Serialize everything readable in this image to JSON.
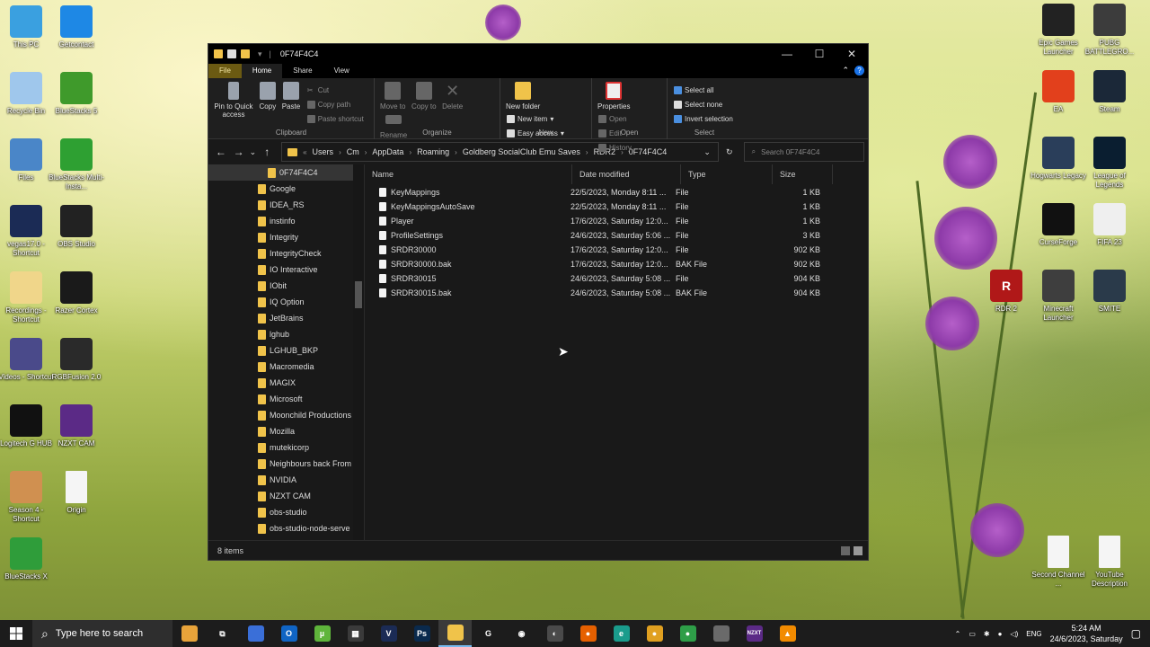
{
  "desktop_left": [
    {
      "label": "This PC",
      "icon": "this-pc-icon",
      "color": "#3aa0e0"
    },
    {
      "label": "Recycle Bin",
      "icon": "recycle-bin-icon",
      "color": "#9fc7ec"
    },
    {
      "label": "Files",
      "icon": "files-icon",
      "color": "#4a86c8"
    },
    {
      "label": "vegas17.0 - Shortcut",
      "icon": "vegas-icon",
      "color": "#1b2b55"
    },
    {
      "label": "Recordings - Shortcut",
      "icon": "folder-icon",
      "color": "#f0d68a"
    },
    {
      "label": "Videos - Shortcut",
      "icon": "videos-icon",
      "color": "#4a4a8a"
    },
    {
      "label": "Logitech G HUB",
      "icon": "logitech-icon",
      "color": "#111111"
    },
    {
      "label": "Season 4 - Shortcut",
      "icon": "season-icon",
      "color": "#d09050"
    },
    {
      "label": "BlueStacks X",
      "icon": "bluestacks-icon",
      "color": "#2f9d3a"
    }
  ],
  "desktop_left2": [
    {
      "label": "Getcontact",
      "icon": "getcontact-icon",
      "color": "#1e88e5"
    },
    {
      "label": "BlueStacks 5",
      "icon": "bluestacks-icon",
      "color": "#3f9a2b"
    },
    {
      "label": "BlueStacks Multi-Insta...",
      "icon": "bluestacks-multi-icon",
      "color": "#2ea032"
    },
    {
      "label": "OBS Studio",
      "icon": "obs-icon",
      "color": "#222222"
    },
    {
      "label": "Razer Cortex",
      "icon": "razer-icon",
      "color": "#1a1a1a"
    },
    {
      "label": "RGBFusion 2.0",
      "icon": "rgbfusion-icon",
      "color": "#2a2a2a"
    },
    {
      "label": "NZXT CAM",
      "icon": "nzxt-icon",
      "color": "#5b2a86"
    },
    {
      "label": "Origin",
      "icon": "file-icon",
      "color": "#f5f5f5"
    }
  ],
  "desktop_right1": [
    {
      "label": "Epic Games Launcher",
      "icon": "epic-icon",
      "color": "#222222"
    },
    {
      "label": "EA",
      "icon": "ea-icon",
      "color": "#e2401c"
    },
    {
      "label": "Hogwarts Legacy",
      "icon": "hogwarts-icon",
      "color": "#2a3e5a"
    },
    {
      "label": "CurseForge",
      "icon": "curseforge-icon",
      "color": "#111111"
    },
    {
      "label": "Minecraft Launcher",
      "icon": "minecraft-icon",
      "color": "#3e3e3e"
    },
    {
      "label": "Second Channel ...",
      "icon": "file-icon",
      "color": "#f5f5f5"
    }
  ],
  "desktop_right2": [
    {
      "label": "PUBG BATTLEGRO...",
      "icon": "pubg-icon",
      "color": "#3c3c3c"
    },
    {
      "label": "Steam",
      "icon": "steam-icon",
      "color": "#1b2838"
    },
    {
      "label": "League of Legends",
      "icon": "lol-icon",
      "color": "#0a1e30"
    },
    {
      "label": "FIFA 23",
      "icon": "fifa-icon",
      "color": "#efefef"
    },
    {
      "label": "SMITE",
      "icon": "smite-icon",
      "color": "#2a3a4a"
    },
    {
      "label": "YouTube Description",
      "icon": "file-icon",
      "color": "#f5f5f5"
    }
  ],
  "desktop_rdr": {
    "label": "RDR 2",
    "icon": "rdr2-icon",
    "color": "#b01818"
  },
  "window": {
    "title": "0F74F4C4",
    "tabs": [
      "File",
      "Home",
      "Share",
      "View"
    ],
    "ribbon": {
      "clipboard": {
        "pin": "Pin to Quick access",
        "copy": "Copy",
        "paste": "Paste",
        "cut": "Cut",
        "copy_path": "Copy path",
        "paste_shortcut": "Paste shortcut",
        "label": "Clipboard"
      },
      "organize": {
        "move": "Move to",
        "copy": "Copy to",
        "delete": "Delete",
        "rename": "Rename",
        "label": "Organize"
      },
      "new": {
        "folder": "New folder",
        "item": "New item",
        "easy": "Easy access",
        "label": "New"
      },
      "open": {
        "properties": "Properties",
        "open": "Open",
        "edit": "Edit",
        "history": "History",
        "label": "Open"
      },
      "select": {
        "all": "Select all",
        "none": "Select none",
        "invert": "Invert selection",
        "label": "Select"
      }
    },
    "breadcrumb": [
      "Users",
      "Cm",
      "AppData",
      "Roaming",
      "Goldberg SocialClub Emu Saves",
      "RDR2",
      "0F74F4C4"
    ],
    "search_placeholder": "Search 0F74F4C4",
    "nav_selected": "0F74F4C4",
    "nav_items": [
      "Google",
      "IDEA_RS",
      "instinfo",
      "Integrity",
      "IntegrityCheck",
      "IO Interactive",
      "IObit",
      "IQ Option",
      "JetBrains",
      "lghub",
      "LGHUB_BKP",
      "Macromedia",
      "MAGIX",
      "Microsoft",
      "Moonchild Productions",
      "Mozilla",
      "mutekicorp",
      "Neighbours back From",
      "NVIDIA",
      "NZXT CAM",
      "obs-studio",
      "obs-studio-node-serve"
    ],
    "columns": [
      "Name",
      "Date modified",
      "Type",
      "Size"
    ],
    "files": [
      {
        "name": "KeyMappings",
        "date": "22/5/2023, Monday 8:11 ...",
        "type": "File",
        "size": "1 KB"
      },
      {
        "name": "KeyMappingsAutoSave",
        "date": "22/5/2023, Monday 8:11 ...",
        "type": "File",
        "size": "1 KB"
      },
      {
        "name": "Player",
        "date": "17/6/2023, Saturday 12:0...",
        "type": "File",
        "size": "1 KB"
      },
      {
        "name": "ProfileSettings",
        "date": "24/6/2023, Saturday 5:06 ...",
        "type": "File",
        "size": "3 KB"
      },
      {
        "name": "SRDR30000",
        "date": "17/6/2023, Saturday 12:0...",
        "type": "File",
        "size": "902 KB"
      },
      {
        "name": "SRDR30000.bak",
        "date": "17/6/2023, Saturday 12:0...",
        "type": "BAK File",
        "size": "902 KB"
      },
      {
        "name": "SRDR30015",
        "date": "24/6/2023, Saturday 5:08 ...",
        "type": "File",
        "size": "904 KB"
      },
      {
        "name": "SRDR30015.bak",
        "date": "24/6/2023, Saturday 5:08 ...",
        "type": "BAK File",
        "size": "904 KB"
      }
    ],
    "status": "8 items"
  },
  "taskbar": {
    "search_placeholder": "Type here to search",
    "apps": [
      {
        "name": "taskbar-app-1",
        "color": "#e8a33a",
        "glyph": ""
      },
      {
        "name": "task-view-icon",
        "color": "#1c1c1c",
        "glyph": "⧉"
      },
      {
        "name": "store-icon",
        "color": "#3a6fd8",
        "glyph": ""
      },
      {
        "name": "outlook-icon",
        "color": "#1065c4",
        "glyph": "O"
      },
      {
        "name": "utorrent-icon",
        "color": "#5fb53b",
        "glyph": "µ"
      },
      {
        "name": "calculator-icon",
        "color": "#3a3a3a",
        "glyph": "▦"
      },
      {
        "name": "vegas-icon",
        "color": "#1b2b55",
        "glyph": "V"
      },
      {
        "name": "photoshop-icon",
        "color": "#0a2a4d",
        "glyph": "Ps"
      },
      {
        "name": "file-explorer-icon",
        "color": "#f0c34a",
        "glyph": ""
      },
      {
        "name": "logitech-icon",
        "color": "#1c1c1c",
        "glyph": "G"
      },
      {
        "name": "obs-icon",
        "color": "#1c1c1c",
        "glyph": "◉"
      },
      {
        "name": "cortana-icon",
        "color": "#4a4a4a",
        "glyph": "◐"
      },
      {
        "name": "firefox-icon",
        "color": "#e66000",
        "glyph": "●"
      },
      {
        "name": "edge-icon",
        "color": "#1a9c8c",
        "glyph": "e"
      },
      {
        "name": "chrome-dev-icon",
        "color": "#e0a020",
        "glyph": "●"
      },
      {
        "name": "chrome-icon",
        "color": "#2e9e48",
        "glyph": "●"
      },
      {
        "name": "taskbar-app-17",
        "color": "#6a6a6a",
        "glyph": ""
      },
      {
        "name": "nzxt-icon",
        "color": "#5b2a86",
        "glyph": "NZXT"
      },
      {
        "name": "vlc-icon",
        "color": "#f28b00",
        "glyph": "▲"
      }
    ],
    "lang": "ENG",
    "time": "5:24 AM",
    "date": "24/6/2023, Saturday"
  }
}
